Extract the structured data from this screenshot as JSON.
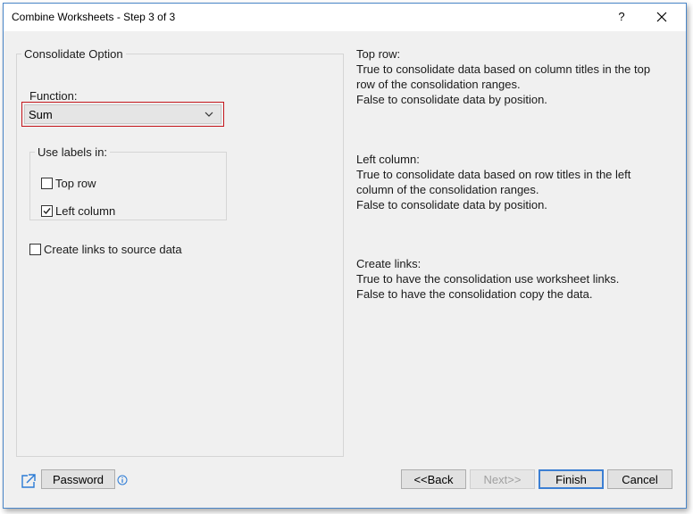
{
  "window": {
    "title": "Combine Worksheets - Step 3 of 3",
    "help_label": "?"
  },
  "consolidate": {
    "group_label": "Consolidate Option",
    "function_label": "Function:",
    "function_value": "Sum",
    "labels_group_label": "Use labels in:",
    "top_row_label": "Top row",
    "top_row_checked": false,
    "left_column_label": "Left column",
    "left_column_checked": true,
    "create_links_label": "Create links to source data",
    "create_links_checked": false
  },
  "help": {
    "top_row": {
      "heading": "Top row:",
      "line1": "True to consolidate data based on column titles in the top",
      "line2": "row of the consolidation ranges.",
      "line3": "False to consolidate data by position."
    },
    "left_column": {
      "heading": "Left column:",
      "line1": "True to consolidate data based on row titles in the left",
      "line2": "column of the consolidation ranges.",
      "line3": "False to consolidate data by position."
    },
    "create_links": {
      "heading": "Create links:",
      "line1": "True to have the consolidation use worksheet links.",
      "line2": "False to have the consolidation copy the data."
    }
  },
  "footer": {
    "password_label": "Password",
    "back_label": "<<Back",
    "next_label": "Next>>",
    "finish_label": "Finish",
    "cancel_label": "Cancel"
  },
  "colors": {
    "highlight_outline": "#c4161c",
    "default_button_border": "#3c7fd3",
    "icon_blue": "#2a7ad5"
  },
  "icons": {
    "share": "share-icon",
    "info": "info-icon",
    "close": "close-icon",
    "dropdown": "chevron-down-icon"
  }
}
